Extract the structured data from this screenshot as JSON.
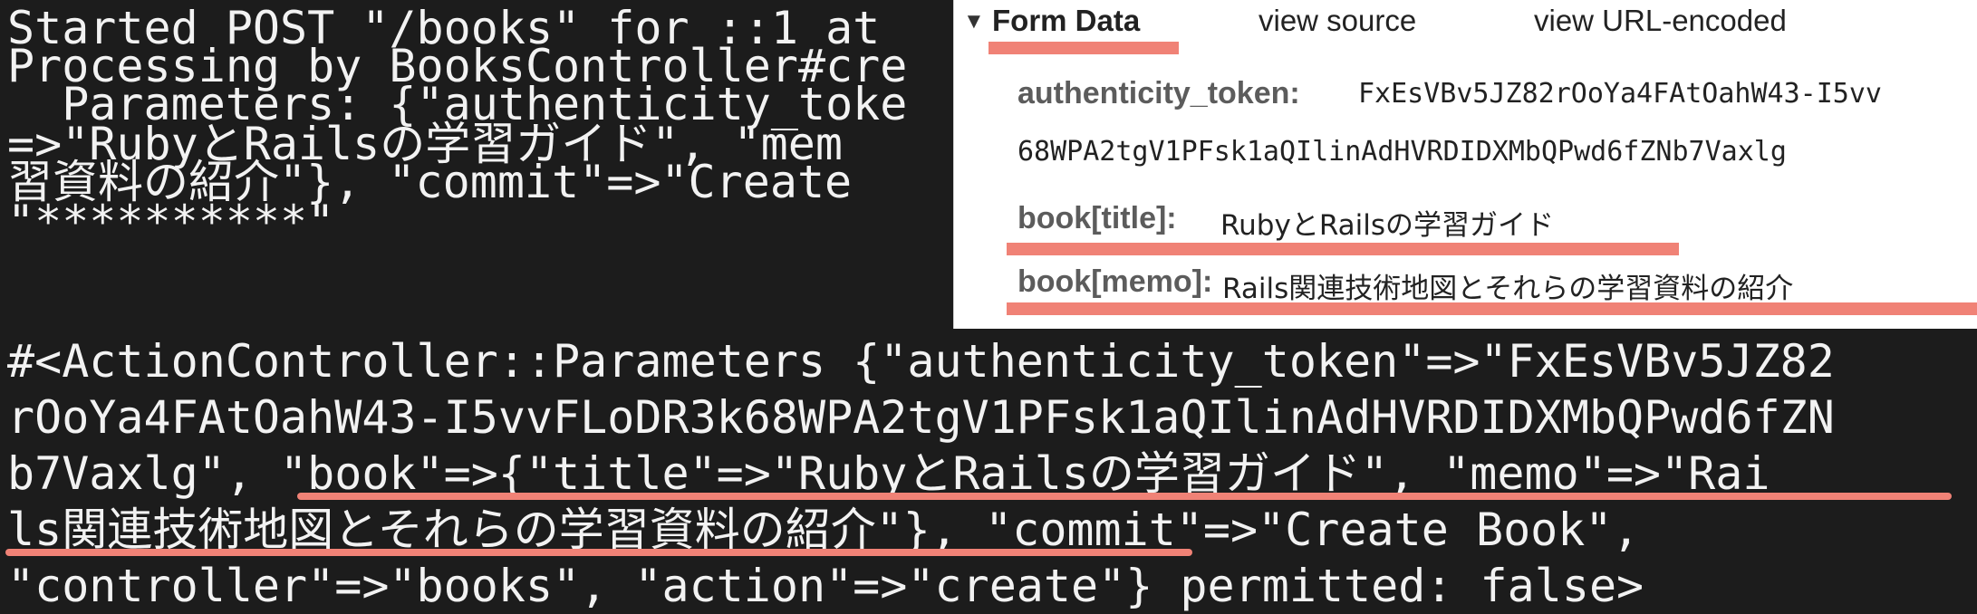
{
  "terminal": {
    "lines": [
      "Started POST \"/books\" for ::1 at",
      "Processing by BooksController#cre",
      "  Parameters: {\"authenticity_toke",
      "=>\"RubyとRailsの学習ガイド\", \"mem",
      "習資料の紹介\"}, \"commit\"=>\"Create",
      "\"**********\"",
      "#<ActionController::Parameters {\"authenticity_token\"=>\"FxEsVBv5JZ82",
      "rOoYa4FAtOahW43-I5vvFLoDR3k68WPA2tgV1PFsk1aQIlinAdHVRDIDXMbQPwd6fZN",
      "b7Vaxlg\", \"book\"=>{\"title\"=>\"RubyとRailsの学習ガイド\", \"memo\"=>\"Rai",
      "ls関連技術地図とそれらの学習資料の紹介\"}, \"commit\"=>\"Create Book\",",
      "\"controller\"=>\"books\", \"action\"=>\"create\"} permitted: false>"
    ]
  },
  "panel": {
    "caret": "▼",
    "title": "Form Data",
    "view_source": "view source",
    "view_url_encoded": "view URL-encoded",
    "fields": [
      {
        "key": "authenticity_token:",
        "value": "FxEsVBv5JZ82rOoYa4FAtOahW43-I5vv"
      },
      {
        "key": "",
        "value": "68WPA2tgV1PFsk1aQIlinAdHVRDIDXMbQPwd6fZNb7Vaxlg"
      },
      {
        "key": "book[title]:",
        "value": "RubyとRailsの学習ガイド"
      },
      {
        "key": "book[memo]:",
        "value": "Rails関連技術地図とそれらの学習資料の紹介"
      }
    ]
  },
  "colors": {
    "terminal_bg": "#1c1c1c",
    "terminal_text": "#f2f2f2",
    "highlight": "#f08276"
  }
}
